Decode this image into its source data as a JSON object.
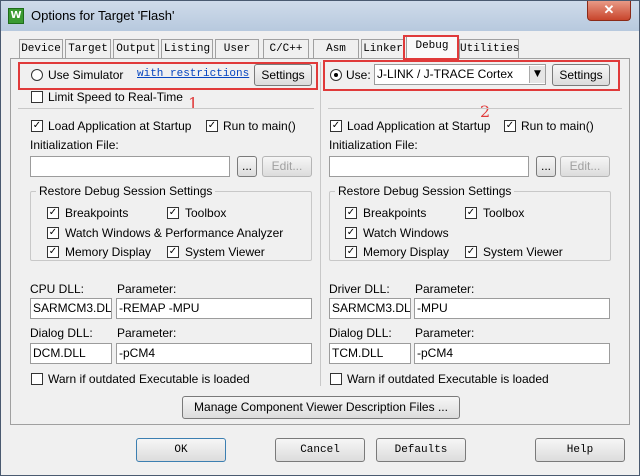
{
  "window": {
    "title": "Options for Target 'Flash'",
    "close_glyph": "✕",
    "app_icon": "keil-icon"
  },
  "tabs": [
    {
      "label": "Device"
    },
    {
      "label": "Target"
    },
    {
      "label": "Output"
    },
    {
      "label": "Listing"
    },
    {
      "label": "User"
    },
    {
      "label": "C/C++"
    },
    {
      "label": "Asm"
    },
    {
      "label": "Linker"
    },
    {
      "label": "Debug"
    },
    {
      "label": "Utilities"
    }
  ],
  "active_tab": "Debug",
  "left": {
    "mode_label": "Use Simulator",
    "restrictions_link": "with restrictions",
    "settings_label": "Settings",
    "limit_speed": "Limit Speed to Real-Time",
    "load_app": "Load Application at Startup",
    "run_main": "Run to main()",
    "init_file_label": "Initialization File:",
    "browse": "...",
    "edit": "Edit...",
    "restore_title": "Restore Debug Session Settings",
    "breakpoints": "Breakpoints",
    "toolbox": "Toolbox",
    "watch": "Watch Windows & Performance Analyzer",
    "memory": "Memory Display",
    "sysviewer": "System Viewer",
    "dll_label": "CPU DLL:",
    "dll_param_label": "Parameter:",
    "dll_value": "SARMCM3.DLL",
    "dll_param": "-REMAP -MPU",
    "dialog_label": "Dialog DLL:",
    "dialog_param_label": "Parameter:",
    "dialog_value": "DCM.DLL",
    "dialog_param": "-pCM4",
    "warn": "Warn if outdated Executable is loaded"
  },
  "right": {
    "mode_label": "Use:",
    "driver_value": "J-LINK / J-TRACE Cortex",
    "settings_label": "Settings",
    "load_app": "Load Application at Startup",
    "run_main": "Run to main()",
    "init_file_label": "Initialization File:",
    "browse": "...",
    "edit": "Edit...",
    "restore_title": "Restore Debug Session Settings",
    "breakpoints": "Breakpoints",
    "toolbox": "Toolbox",
    "watch": "Watch Windows",
    "memory": "Memory Display",
    "sysviewer": "System Viewer",
    "dll_label": "Driver DLL:",
    "dll_param_label": "Parameter:",
    "dll_value": "SARMCM3.DLL",
    "dll_param": "-MPU",
    "dialog_label": "Dialog DLL:",
    "dialog_param_label": "Parameter:",
    "dialog_value": "TCM.DLL",
    "dialog_param": "-pCM4",
    "warn": "Warn if outdated Executable is loaded"
  },
  "manage_button": "Manage Component Viewer Description Files ...",
  "footer": {
    "ok": "OK",
    "cancel": "Cancel",
    "defaults": "Defaults",
    "help": "Help"
  },
  "annotations": {
    "one": "1",
    "two": "2"
  },
  "check_glyph": "✓",
  "dropdown_glyph": "▼"
}
